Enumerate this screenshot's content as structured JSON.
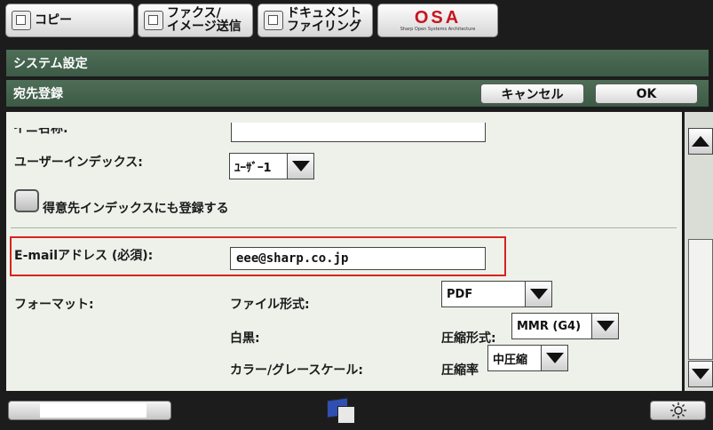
{
  "tabs": {
    "copy": "コピー",
    "fax_line1": "ファクス/",
    "fax_line2": "イメージ送信",
    "doc_line1": "ドキュメント",
    "doc_line2": "ファイリング",
    "osa": "OSA",
    "osa_sub": "Sharp Open Systems Architecture"
  },
  "header": {
    "system_settings": "システム設定",
    "address_registration": "宛先登録",
    "cancel_label": "キャンセル",
    "ok_label": "OK"
  },
  "form": {
    "partial_label": "イニ名称:",
    "user_index_label": "ユーザーインデックス:",
    "user_index_value": "ﾕｰｻﾞｰ1",
    "favorite_label": "得意先インデックスにも登録する",
    "email_label": "E-mailアドレス (必須):",
    "email_value": "eee@sharp.co.jp",
    "format_label": "フォーマット:",
    "file_format_label": "ファイル形式:",
    "file_format_value": "PDF",
    "mono_label": "白黒:",
    "compression_format_label": "圧縮形式:",
    "compression_format_value": "MMR (G4)",
    "color_gray_label": "カラー/グレースケール:",
    "compression_rate_label": "圧縮率",
    "compression_rate_value": "中圧縮"
  },
  "colors": {
    "header_green": "#3f5d48",
    "panel_bg": "#eef1ea",
    "highlight_red": "#d8231c"
  },
  "icons": [
    "copy-icon",
    "fax-icon",
    "document-filing-icon",
    "job-status-icon",
    "brightness-icon"
  ]
}
